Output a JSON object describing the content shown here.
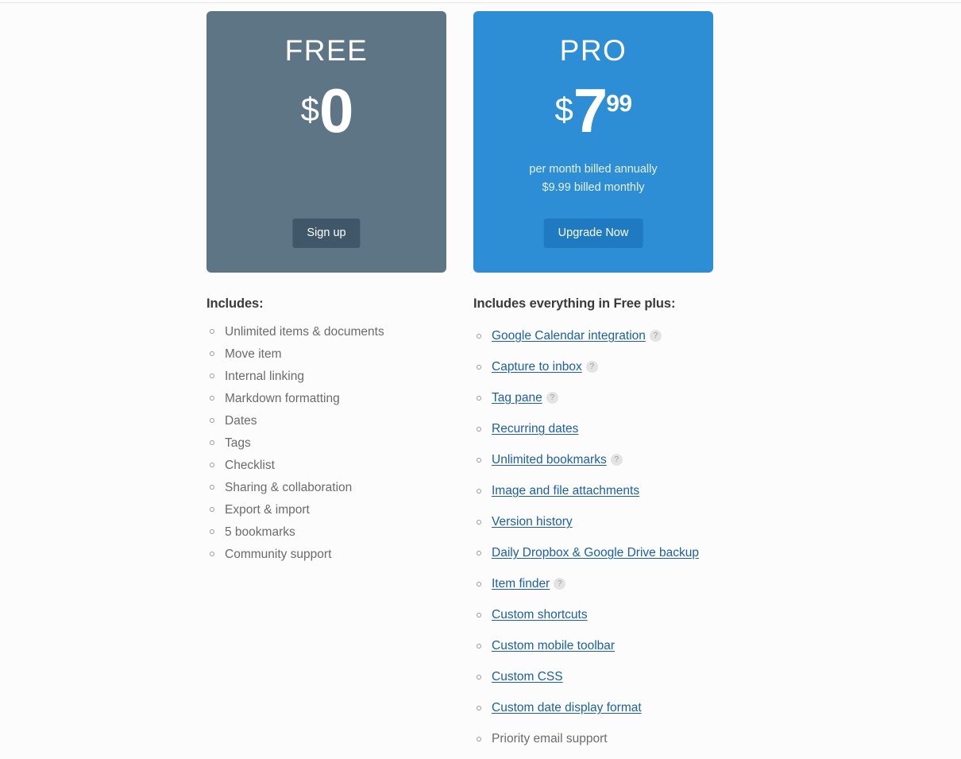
{
  "colors": {
    "page_background": "#fcfcfc",
    "free_card": "#5d7585",
    "pro_card": "#2e8ed5",
    "signup_button": "#3f5769",
    "upgrade_button": "#1f7ac2",
    "link": "#1c5fa8",
    "body_text": "#6b6b6b",
    "heading_text": "#3a3a3a",
    "help_badge_background": "#e3e3e3"
  },
  "plans": {
    "free": {
      "name": "FREE",
      "currency": "$",
      "amount": "0",
      "cents": "",
      "cta_label": "Sign up",
      "includes_heading": "Includes:",
      "features": [
        {
          "label": "Unlimited items & documents",
          "is_link": false,
          "has_help": false
        },
        {
          "label": "Move item",
          "is_link": false,
          "has_help": false
        },
        {
          "label": "Internal linking",
          "is_link": false,
          "has_help": false
        },
        {
          "label": "Markdown formatting",
          "is_link": false,
          "has_help": false
        },
        {
          "label": "Dates",
          "is_link": false,
          "has_help": false
        },
        {
          "label": "Tags",
          "is_link": false,
          "has_help": false
        },
        {
          "label": "Checklist",
          "is_link": false,
          "has_help": false
        },
        {
          "label": "Sharing & collaboration",
          "is_link": false,
          "has_help": false
        },
        {
          "label": "Export & import",
          "is_link": false,
          "has_help": false
        },
        {
          "label": "5 bookmarks",
          "is_link": false,
          "has_help": false
        },
        {
          "label": "Community support",
          "is_link": false,
          "has_help": false
        }
      ]
    },
    "pro": {
      "name": "PRO",
      "currency": "$",
      "amount": "7",
      "cents": "99",
      "billing_line1": "per month billed annually",
      "billing_line2": "$9.99 billed monthly",
      "cta_label": "Upgrade Now",
      "includes_heading": "Includes everything in Free plus:",
      "help_badge_glyph": "?",
      "features": [
        {
          "label": "Google Calendar integration",
          "is_link": true,
          "has_help": true
        },
        {
          "label": "Capture to inbox",
          "is_link": true,
          "has_help": true
        },
        {
          "label": "Tag pane",
          "is_link": true,
          "has_help": true
        },
        {
          "label": "Recurring dates",
          "is_link": true,
          "has_help": false
        },
        {
          "label": "Unlimited bookmarks",
          "is_link": true,
          "has_help": true
        },
        {
          "label": "Image and file attachments",
          "is_link": true,
          "has_help": false
        },
        {
          "label": "Version history",
          "is_link": true,
          "has_help": false
        },
        {
          "label": "Daily Dropbox & Google Drive backup",
          "is_link": true,
          "has_help": false
        },
        {
          "label": "Item finder",
          "is_link": true,
          "has_help": true
        },
        {
          "label": "Custom shortcuts",
          "is_link": true,
          "has_help": false
        },
        {
          "label": "Custom mobile toolbar",
          "is_link": true,
          "has_help": false
        },
        {
          "label": "Custom CSS",
          "is_link": true,
          "has_help": false
        },
        {
          "label": "Custom date display format",
          "is_link": true,
          "has_help": false
        },
        {
          "label": "Priority email support",
          "is_link": false,
          "has_help": false
        }
      ]
    }
  }
}
